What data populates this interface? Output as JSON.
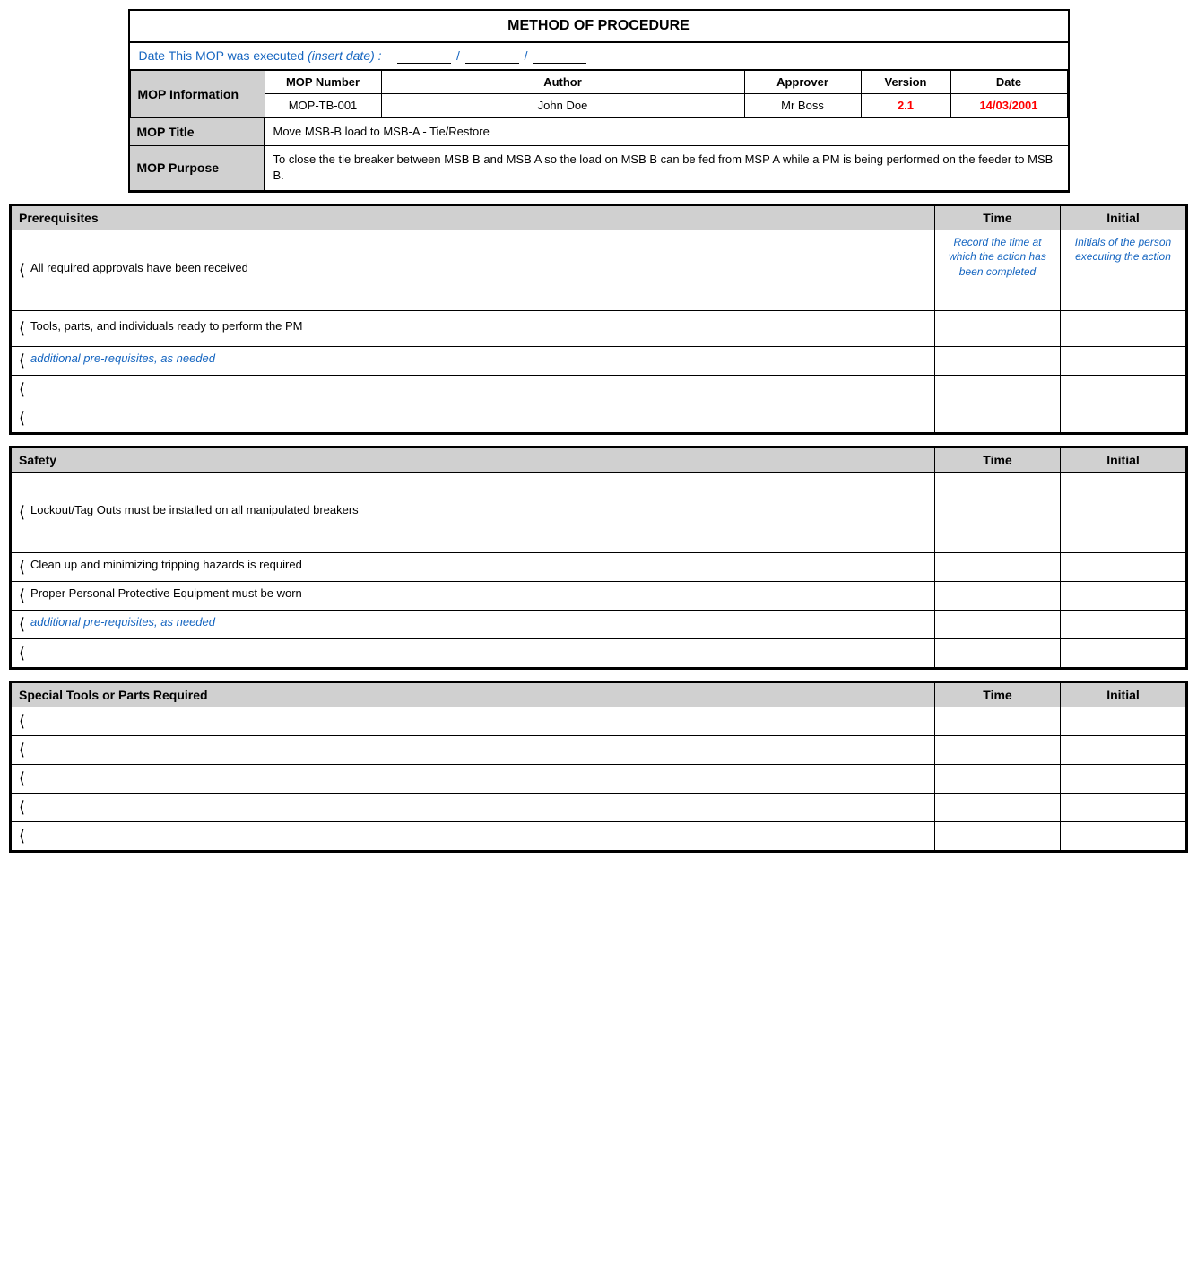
{
  "title": "METHOD OF PROCEDURE",
  "date_label": "Date This MOP was executed",
  "date_italic": "(insert date) :",
  "mop_info": {
    "header_label": "MOP Information",
    "columns": [
      "MOP Number",
      "Author",
      "Approver",
      "Version",
      "Date"
    ],
    "values": {
      "mop_number": "MOP-TB-001",
      "author": "John Doe",
      "approver": "Mr Boss",
      "version": "2.1",
      "date": "14/03/2001"
    }
  },
  "mop_title_label": "MOP Title",
  "mop_title_value": "Move MSB-B load to MSB-A - Tie/Restore",
  "mop_purpose_label": "MOP Purpose",
  "mop_purpose_value": "To close the tie breaker between MSB B and MSB A so the load on MSB B can be fed from MSP A while a PM is being performed on the feeder to MSB B.",
  "prerequisites": {
    "header": "Prerequisites",
    "time_header": "Time",
    "initial_header": "Initial",
    "rows": [
      {
        "desc": "All required approvals have been received",
        "time_hint": "Record the time at which the action has been completed",
        "initial_hint": "Initials of the person executing the action",
        "tall": true
      },
      {
        "desc": "Tools, parts, and individuals ready to perform the PM",
        "time_hint": "",
        "initial_hint": "",
        "tall": false
      },
      {
        "desc": "additional pre-requisites, as needed",
        "italic": true,
        "time_hint": "",
        "initial_hint": "",
        "tall": false
      },
      {
        "desc": "",
        "time_hint": "",
        "initial_hint": "",
        "tall": false
      },
      {
        "desc": "",
        "time_hint": "",
        "initial_hint": "",
        "tall": false
      }
    ]
  },
  "safety": {
    "header": "Safety",
    "time_header": "Time",
    "initial_header": "Initial",
    "rows": [
      {
        "desc": "Lockout/Tag Outs must be installed on all manipulated breakers",
        "tall": true
      },
      {
        "desc": "Clean up and minimizing tripping hazards is required",
        "tall": false
      },
      {
        "desc": "Proper Personal Protective Equipment must be worn",
        "tall": false
      },
      {
        "desc": "additional pre-requisites, as needed",
        "italic": true,
        "tall": false
      },
      {
        "desc": "",
        "tall": false
      }
    ]
  },
  "special_tools": {
    "header": "Special Tools or Parts Required",
    "time_header": "Time",
    "initial_header": "Initial",
    "rows": [
      {
        "desc": ""
      },
      {
        "desc": ""
      },
      {
        "desc": ""
      },
      {
        "desc": ""
      },
      {
        "desc": ""
      }
    ]
  }
}
